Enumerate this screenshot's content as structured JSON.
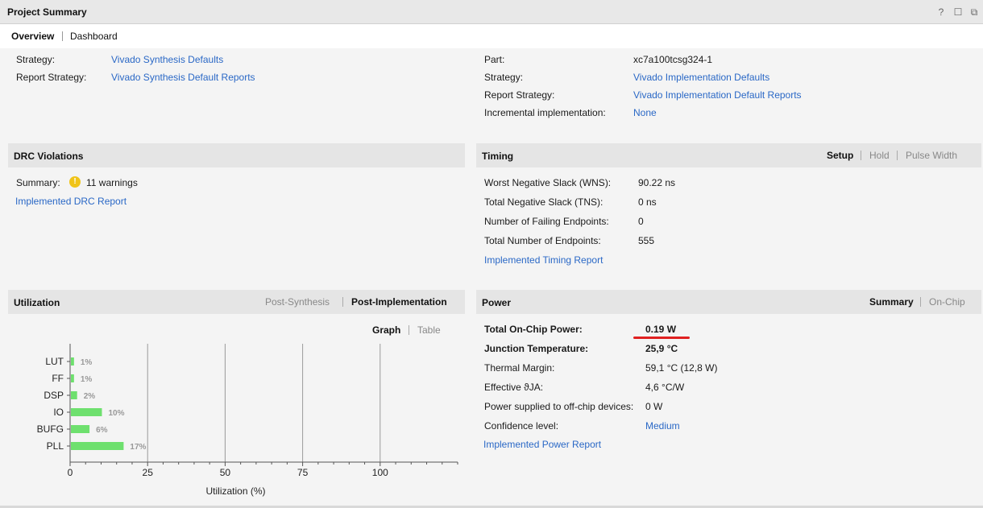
{
  "panel": {
    "title": "Project Summary"
  },
  "window_controls": {
    "help": "?",
    "restore": "☐",
    "maximize": "⧉"
  },
  "tabs": [
    {
      "label": "Overview",
      "active": true
    },
    {
      "label": "Dashboard",
      "active": false
    }
  ],
  "synthesis": {
    "strategy_label": "Strategy:",
    "strategy_value": "Vivado Synthesis Defaults",
    "report_strategy_label": "Report Strategy:",
    "report_strategy_value": "Vivado Synthesis Default Reports"
  },
  "implementation": {
    "part_label": "Part:",
    "part_value": "xc7a100tcsg324-1",
    "strategy_label": "Strategy:",
    "strategy_value": "Vivado Implementation Defaults",
    "report_strategy_label": "Report Strategy:",
    "report_strategy_value": "Vivado Implementation Default Reports",
    "incremental_label": "Incremental implementation:",
    "incremental_value": "None"
  },
  "drc": {
    "title": "DRC Violations",
    "summary_label": "Summary:",
    "warning_icon": "!",
    "summary_value": "11 warnings",
    "report_link": "Implemented DRC Report"
  },
  "timing": {
    "title": "Timing",
    "tabs": [
      "Setup",
      "Hold",
      "Pulse Width"
    ],
    "active_tab": "Setup",
    "rows": [
      {
        "label": "Worst Negative Slack (WNS):",
        "value": "90.22 ns"
      },
      {
        "label": "Total Negative Slack (TNS):",
        "value": "0 ns"
      },
      {
        "label": "Number of Failing Endpoints:",
        "value": "0"
      },
      {
        "label": "Total Number of Endpoints:",
        "value": "555"
      }
    ],
    "report_link": "Implemented Timing Report"
  },
  "utilization": {
    "title": "Utilization",
    "tabs": [
      "Post-Synthesis",
      "Post-Implementation"
    ],
    "active_tab": "Post-Implementation",
    "view_tabs": [
      "Graph",
      "Table"
    ],
    "active_view": "Graph"
  },
  "power": {
    "title": "Power",
    "tabs": [
      "Summary",
      "On-Chip"
    ],
    "active_tab": "Summary",
    "rows": [
      {
        "label": "Total On-Chip Power:",
        "value": "0.19 W",
        "bold": true
      },
      {
        "label": "Junction Temperature:",
        "value": "25,9 °C",
        "bold": true
      },
      {
        "label": "Thermal Margin:",
        "value": "59,1 °C (12,8 W)"
      },
      {
        "label": "Effective ϑJA:",
        "value": "4,6 °C/W"
      },
      {
        "label": "Power supplied to off-chip devices:",
        "value": "0 W"
      },
      {
        "label": "Confidence level:",
        "value": "Medium",
        "link": true
      }
    ],
    "report_link": "Implemented Power Report",
    "highlight_color": "#e02020"
  },
  "chart_data": {
    "type": "bar",
    "orientation": "horizontal",
    "categories": [
      "LUT",
      "FF",
      "DSP",
      "IO",
      "BUFG",
      "PLL"
    ],
    "values": [
      1,
      1,
      2,
      10,
      6,
      17
    ],
    "value_labels": [
      "1%",
      "1%",
      "2%",
      "10%",
      "6%",
      "17%"
    ],
    "xlabel": "Utilization (%)",
    "xticks": [
      0,
      25,
      50,
      75,
      100
    ],
    "xlim": [
      0,
      125
    ],
    "grid": true,
    "bar_color": "#6ee06e"
  }
}
